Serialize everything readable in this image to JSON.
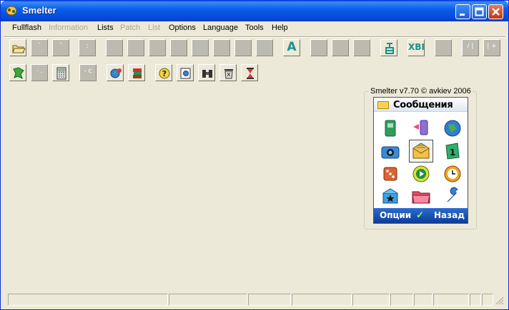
{
  "window": {
    "title": "Smelter"
  },
  "menu": [
    {
      "label": "Fullflash",
      "enabled": true
    },
    {
      "label": "Information",
      "enabled": false
    },
    {
      "label": "Lists",
      "enabled": true
    },
    {
      "label": "Patch",
      "enabled": false
    },
    {
      "label": "List",
      "enabled": false
    },
    {
      "label": "Options",
      "enabled": true
    },
    {
      "label": "Language",
      "enabled": true
    },
    {
      "label": "Tools",
      "enabled": true
    },
    {
      "label": "Help",
      "enabled": true
    }
  ],
  "toolbar1_glyphs": {
    "b_a": "A",
    "b_xbi": "XBI"
  },
  "group": {
    "label": "Smelter v7.70  © avkiev  2006"
  },
  "phone": {
    "header_title": "Сообщения",
    "left_soft": "Опции",
    "check_mark": "✓",
    "right_soft": "Назад"
  },
  "colors": {
    "title_bar": "#0a5ee8",
    "window_bg": "#ece9d8",
    "phone_footer": "#0b3c97"
  }
}
